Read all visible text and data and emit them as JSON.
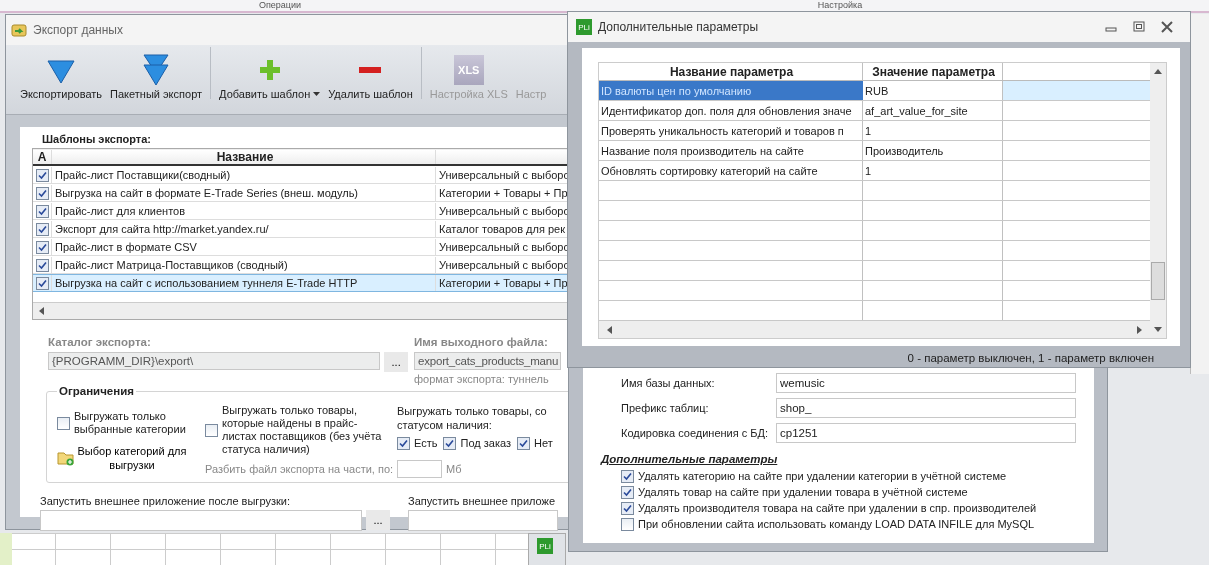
{
  "ribbon_groups": [
    {
      "label": "Операции"
    },
    {
      "label": "Настройка"
    }
  ],
  "export_window": {
    "title": "Экспорт данных",
    "toolbar": [
      {
        "label": "Экспортировать",
        "kind": "export",
        "disabled": false,
        "dropdown": false
      },
      {
        "label": "Пакетный экспорт",
        "kind": "batch",
        "disabled": false,
        "dropdown": false
      },
      {
        "label": "Добавить шаблон",
        "kind": "add",
        "disabled": false,
        "dropdown": true
      },
      {
        "label": "Удалить шаблон",
        "kind": "remove",
        "disabled": false,
        "dropdown": false
      },
      {
        "label": "Настройка XLS",
        "kind": "xls",
        "icon_text": "XLS",
        "disabled": true,
        "dropdown": false
      },
      {
        "label": "Настр",
        "kind": "plain",
        "disabled": true,
        "dropdown": false
      }
    ],
    "templates": {
      "title": "Шаблоны экспорта:",
      "columns": [
        "А",
        "Название"
      ],
      "rows": [
        {
          "checked": true,
          "name": "Прайс-лист Поставщики(сводный)",
          "column_3": "Универсальный с выборо",
          "selected": false
        },
        {
          "checked": true,
          "name": "Выгрузка на сайт в формате E-Trade Series (внеш. модуль)",
          "column_3": "Категории + Товары + Пр",
          "selected": false
        },
        {
          "checked": true,
          "name": "Прайс-лист для клиентов",
          "column_3": "Универсальный с выборо",
          "selected": false
        },
        {
          "checked": true,
          "name": "Экспорт для сайта http://market.yandex.ru/",
          "column_3": "Каталог товаров для рек",
          "selected": false
        },
        {
          "checked": true,
          "name": "Прайс-лист в формате CSV",
          "column_3": "Универсальный с выборо",
          "selected": false
        },
        {
          "checked": true,
          "name": "Прайс-лист Матрица-Поставщиков (сводный)",
          "column_3": "Универсальный с выборо",
          "selected": false
        },
        {
          "checked": true,
          "name": "Выгрузка на сайт с использованием туннеля E-Trade HTTP",
          "column_3": "Категории + Товары + Пр",
          "selected": true
        }
      ]
    },
    "catalog": {
      "label": "Каталог экспорта:",
      "value": "{PROGRAMM_DIR}\\export\\",
      "browse": "...",
      "disabled": true
    },
    "output_file": {
      "label": "Имя выходного файла:",
      "value": "export_cats_products_manu",
      "note": "формат экспорта: туннель"
    },
    "limits": {
      "title": "Ограничения",
      "only_selected_categories": {
        "label": "Выгружать только выбранные категории",
        "checked": false
      },
      "choose_categories_button": "Выбор категорий для выгрузки",
      "only_found_products": {
        "label": "Выгружать только товары, которые найдены в прайс-листах поставщиков (без учёта статуса наличия)",
        "checked": false
      },
      "availability": {
        "label": "Выгружать только товары, со статусом наличия:",
        "options": [
          {
            "label": "Есть",
            "checked": true
          },
          {
            "label": "Под заказ",
            "checked": true
          },
          {
            "label": "Нет",
            "checked": true
          }
        ]
      },
      "split": {
        "label": "Разбить файл экспорта на части, по:",
        "unit": "Мб",
        "disabled": true
      }
    },
    "run_after": {
      "label": "Запустить внешнее приложение после выгрузки:",
      "browse": "..."
    },
    "run_before": {
      "label": "Запустить внешнее приложе"
    }
  },
  "params_dialog": {
    "title": "Дополнительные параметры",
    "icon_text": "PLi",
    "columns": [
      "Название параметра",
      "Значение параметра"
    ],
    "rows": [
      {
        "name": "ID валюты цен по умолчанию",
        "value": "RUB",
        "selected": true
      },
      {
        "name": "Идентификатор доп. поля для обновления значе",
        "value": "af_art_value_for_site",
        "selected": false
      },
      {
        "name": "Проверять уникальность категорий и товаров п",
        "value": "1",
        "selected": false
      },
      {
        "name": "Название поля производитель на сайте",
        "value": "Производитель",
        "selected": false
      },
      {
        "name": "Обновлять сортировку категорий на сайте",
        "value": "1",
        "selected": false
      }
    ],
    "status": "0 - параметр выключен, 1 - параметр включен"
  },
  "db_window": {
    "fields": [
      {
        "label": "Имя базы данных:",
        "value": "wemusic"
      },
      {
        "label": "Префикс таблиц:",
        "value": "shop_"
      },
      {
        "label": "Кодировка соединения с БД:",
        "value": "cp1251"
      }
    ],
    "section_title": "Дополнительные параметры",
    "options": [
      {
        "label": "Удалять категорию на сайте при удалении категории в учётной системе",
        "checked": true
      },
      {
        "label": "Удалять товар на сайте при удалении товара в учётной системе",
        "checked": true
      },
      {
        "label": "Удалять производителя товара на сайте при удалении в спр. производителей",
        "checked": true
      },
      {
        "label": "При обновлении сайта использовать команду LOAD DATA INFILE для MySQL",
        "checked": false
      }
    ]
  },
  "taskbar_window": {
    "icon_text": "PLi"
  }
}
